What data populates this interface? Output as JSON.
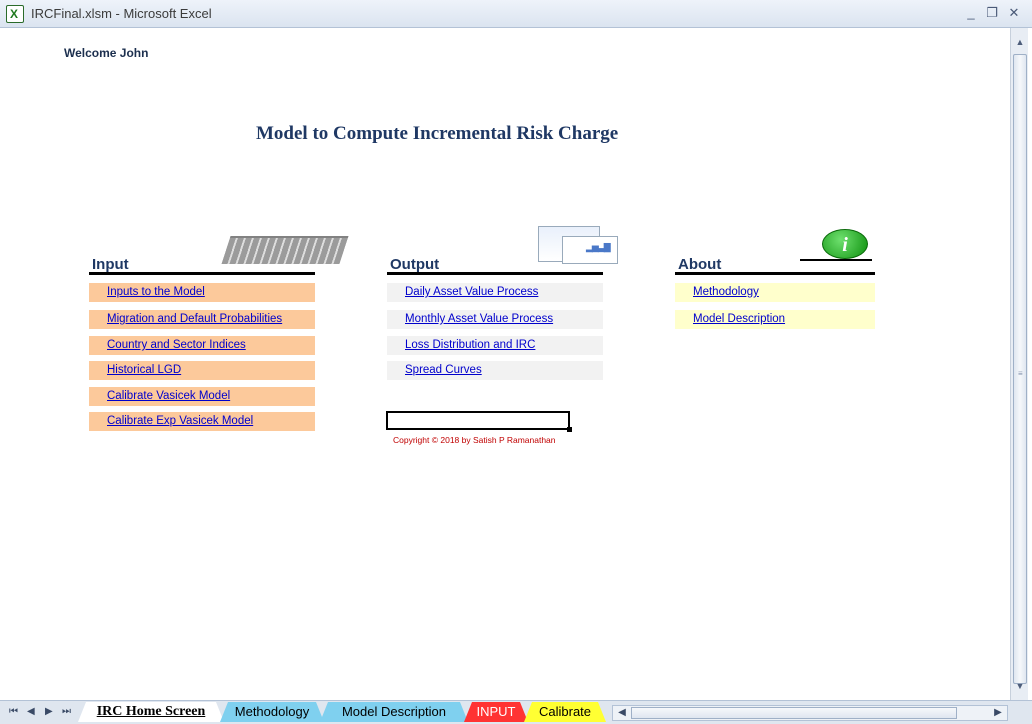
{
  "window": {
    "title": "IRCFinal.xlsm - Microsoft Excel",
    "minimize": "_",
    "restore": "❐",
    "close": "✕"
  },
  "sheet": {
    "welcome": "Welcome John",
    "title": "Model to Compute Incremental Risk Charge",
    "input": {
      "heading": "Input",
      "items": [
        "Inputs to the Model",
        "Migration and Default Probabilities",
        "Country and Sector Indices",
        "Historical LGD",
        "Calibrate Vasicek Model",
        "Calibrate Exp Vasicek Model"
      ]
    },
    "output": {
      "heading": "Output",
      "items": [
        "Daily Asset Value Process",
        "Monthly Asset Value Process",
        "Loss Distribution and IRC",
        "Spread Curves"
      ]
    },
    "about": {
      "heading": "About",
      "items": [
        "Methodology",
        "Model Description"
      ]
    },
    "info_glyph": "i",
    "chart_glyph": "▂▅▃▇",
    "copyright": "Copyright © 2018 by Satish P Ramanathan"
  },
  "tabs": {
    "nav": [
      "⏮",
      "◀",
      "▶",
      "⏭"
    ],
    "items": [
      {
        "label": "IRC Home Screen",
        "color": "#ffffff"
      },
      {
        "label": "Methodology",
        "color": "#7fd0ef"
      },
      {
        "label": "Model Description",
        "color": "#7fd0ef"
      },
      {
        "label": "INPUT",
        "color": "#ff3333",
        "text_color": "#ffffff"
      },
      {
        "label": "Calibrate",
        "color": "#ffff33"
      }
    ]
  },
  "icons": {
    "app": "excel-icon",
    "keyboard": "keyboard-icon",
    "report": "report-icon",
    "info": "info-icon"
  }
}
